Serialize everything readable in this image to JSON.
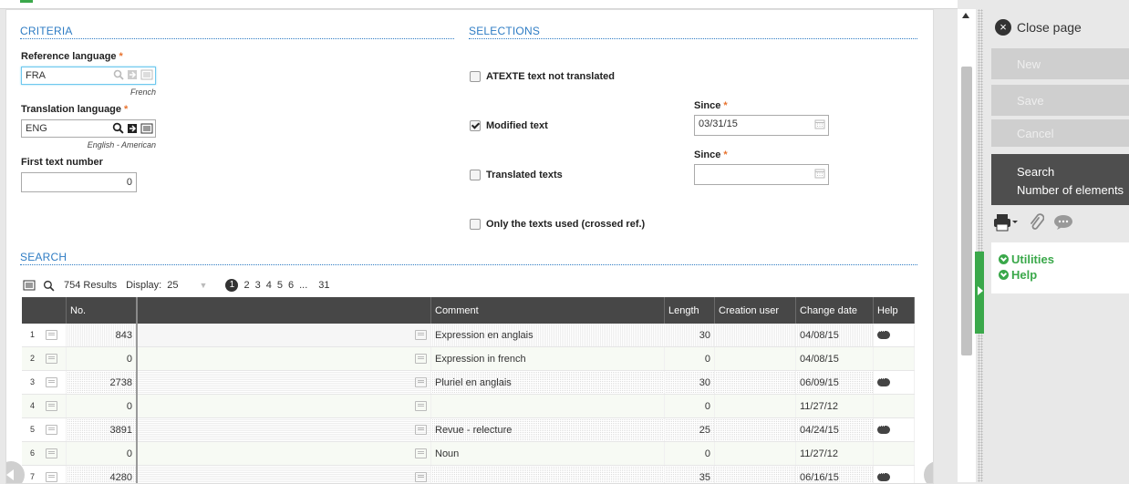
{
  "criteria": {
    "title": "CRITERIA",
    "ref_lang": {
      "label": "Reference language",
      "value": "FRA",
      "hint": "French"
    },
    "trans_lang": {
      "label": "Translation language",
      "value": "ENG",
      "hint": "English - American"
    },
    "first_text": {
      "label": "First text number",
      "value": "0"
    },
    "required_mark": "*"
  },
  "selections": {
    "title": "SELECTIONS",
    "atexte": {
      "label": "ATEXTE text not translated",
      "checked": false
    },
    "modified": {
      "label": "Modified text",
      "checked": true,
      "since_label": "Since",
      "since_value": "03/31/15"
    },
    "translated": {
      "label": "Translated texts",
      "checked": false,
      "since_label": "Since",
      "since_value": ""
    },
    "only_used": {
      "label": "Only the texts used (crossed ref.)",
      "checked": false
    }
  },
  "search": {
    "title": "SEARCH",
    "results": "754 Results",
    "display_label": "Display:",
    "display_value": "25",
    "pages": [
      "1",
      "2",
      "3",
      "4",
      "5",
      "6",
      "...",
      "31"
    ],
    "columns": [
      "No.",
      "Comment",
      "Length",
      "Creation user",
      "Change date",
      "Help"
    ],
    "rows": [
      {
        "n": "1",
        "no": "843",
        "comment": "Expression en anglais",
        "length": "30",
        "user": "",
        "date": "04/08/15",
        "help": true
      },
      {
        "n": "2",
        "no": "0",
        "comment": "Expression in french",
        "length": "0",
        "user": "",
        "date": "04/08/15",
        "help": false
      },
      {
        "n": "3",
        "no": "2738",
        "comment": "Pluriel en anglais",
        "length": "30",
        "user": "",
        "date": "06/09/15",
        "help": true
      },
      {
        "n": "4",
        "no": "0",
        "comment": "",
        "length": "0",
        "user": "",
        "date": "11/27/12",
        "help": false
      },
      {
        "n": "5",
        "no": "3891",
        "comment": "Revue - relecture",
        "length": "25",
        "user": "",
        "date": "04/24/15",
        "help": true
      },
      {
        "n": "6",
        "no": "0",
        "comment": "Noun",
        "length": "0",
        "user": "",
        "date": "11/27/12",
        "help": false
      },
      {
        "n": "7",
        "no": "4280",
        "comment": "",
        "length": "35",
        "user": "",
        "date": "06/16/15",
        "help": true
      }
    ]
  },
  "sidebar": {
    "close": "Close page",
    "new": "New",
    "save": "Save",
    "cancel": "Cancel",
    "search": "Search",
    "count": "Number of elements",
    "utilities": "Utilities",
    "help": "Help"
  }
}
